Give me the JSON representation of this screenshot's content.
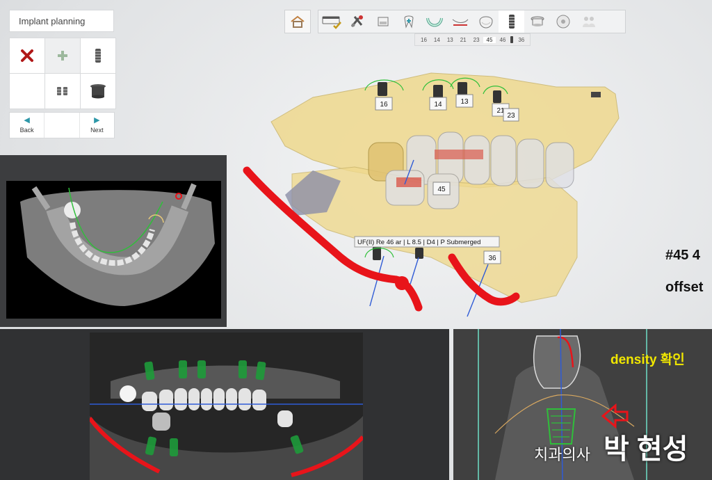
{
  "panel": {
    "title": "Implant planning",
    "tools": [
      {
        "icon": "delete-x-icon"
      },
      {
        "icon": "add-plus-icon"
      },
      {
        "icon": "implant-screw-icon"
      },
      {
        "icon": "empty-slot"
      },
      {
        "icon": "abutment-icon"
      },
      {
        "icon": "sleeve-icon"
      }
    ],
    "back_label": "Back",
    "next_label": "Next"
  },
  "workflow": {
    "steps": [
      {
        "icon": "home-icon"
      },
      {
        "icon": "scan-tray-check-icon"
      },
      {
        "icon": "tools-pliers-icon"
      },
      {
        "icon": "scan-box-icon"
      },
      {
        "icon": "tooth-add-icon"
      },
      {
        "icon": "arch-icon"
      },
      {
        "icon": "ruler-jaw-icon"
      },
      {
        "icon": "crown-icon"
      },
      {
        "icon": "implant-icon"
      },
      {
        "icon": "sleeve-ring-icon"
      },
      {
        "icon": "disc-icon"
      },
      {
        "icon": "people-icon"
      }
    ],
    "active_step": 8
  },
  "tooth_strip": [
    "16",
    "14",
    "13",
    "21",
    "23",
    "45",
    "46",
    "36"
  ],
  "selected_tooth": "45",
  "viewport": {
    "labels": {
      "t16": "16",
      "t14": "14",
      "t13": "13",
      "t21": "21",
      "t23": "23",
      "t45": "45",
      "t36": "36"
    },
    "tooltip": "UF(II) Re 46 ar | L 8.5 | D4 | P Submerged"
  },
  "side_text": {
    "line1": "#45 4",
    "line2": "offset"
  },
  "annotations": {
    "density": "density 확인",
    "sig_small": "치과의사",
    "sig_big": "박 현성"
  },
  "colors": {
    "nerve_canal": "#e8141a",
    "implant_outline": "#2fbf3a",
    "model": "#f0d98a",
    "accent": "#2d97a8",
    "density_text": "#f1e700"
  }
}
